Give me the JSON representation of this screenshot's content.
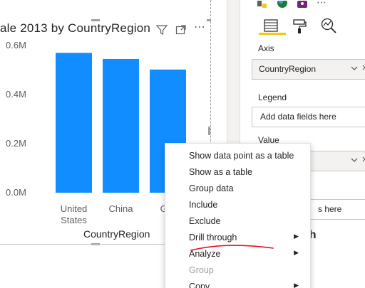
{
  "visual": {
    "title": "ale 2013 by CountryRegion",
    "more_label": "⋯",
    "x_axis_title": "CountryRegion"
  },
  "chart_data": {
    "type": "bar",
    "categories": [
      "United States",
      "China",
      "Ger"
    ],
    "category_lines": [
      [
        "United",
        "States"
      ],
      [
        "China"
      ],
      [
        "Ger"
      ]
    ],
    "values": [
      570000,
      545000,
      502000
    ],
    "y_tick_labels": [
      "0.6M",
      "0.4M",
      "0.2M",
      "0.0M"
    ],
    "y_tick_values": [
      600000,
      400000,
      200000,
      0
    ],
    "ylim": [
      0,
      600000
    ],
    "xlabel": "CountryRegion",
    "ylabel": "",
    "bar_color": "#118dff",
    "grid": false
  },
  "pane": {
    "more_label": "⋯",
    "wells": {
      "axis": {
        "label": "Axis",
        "value": "CountryRegion"
      },
      "legend": {
        "label": "Legend",
        "placeholder": "Add data fields here"
      },
      "value": {
        "label": "Value",
        "placeholder": "s here"
      }
    },
    "drill_heading": "gh"
  },
  "context_menu": {
    "items": [
      {
        "label": "Show data point as a table",
        "submenu": false,
        "disabled": false
      },
      {
        "label": "Show as a table",
        "submenu": false,
        "disabled": false
      },
      {
        "label": "Group data",
        "submenu": false,
        "disabled": false
      },
      {
        "label": "Include",
        "submenu": false,
        "disabled": false
      },
      {
        "label": "Exclude",
        "submenu": false,
        "disabled": false
      },
      {
        "label": "Drill through",
        "submenu": true,
        "disabled": false
      },
      {
        "label": "Analyze",
        "submenu": true,
        "disabled": false
      },
      {
        "label": "Group",
        "submenu": false,
        "disabled": true
      },
      {
        "label": "Copy",
        "submenu": true,
        "disabled": false
      }
    ],
    "submenu_glyph": "▶"
  },
  "colors": {
    "accent_yellow": "#f2c811",
    "annotation_red": "#e81123",
    "bar_blue": "#118dff"
  }
}
